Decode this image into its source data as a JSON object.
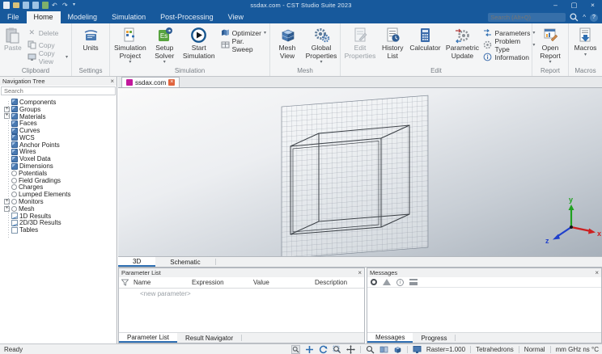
{
  "titlebar": {
    "title": "ssdax.com - CST Studio Suite 2023",
    "window_controls": {
      "minimize": "–",
      "maximize": "▢",
      "close": "×"
    }
  },
  "tabs": {
    "items": [
      "File",
      "Home",
      "Modeling",
      "Simulation",
      "Post-Processing",
      "View"
    ],
    "active": "Home",
    "search_placeholder": "Search (Alt+Q)",
    "collapse_glyph": "^",
    "help_glyph": "?"
  },
  "icons": {
    "caret": "▾",
    "close": "×",
    "plus": "+",
    "play": "▶",
    "solver_badge": "Es"
  },
  "ribbon": {
    "clipboard": {
      "label": "Clipboard",
      "paste": "Paste",
      "delete": "Delete",
      "copy": "Copy",
      "copy_view": "Copy View"
    },
    "settings": {
      "label": "Settings",
      "units": "Units"
    },
    "simulation": {
      "label": "Simulation",
      "simulation_project": "Simulation Project",
      "setup_solver": "Setup Solver",
      "start_simulation": "Start Simulation",
      "optimizer": "Optimizer",
      "par_sweep": "Par. Sweep"
    },
    "mesh": {
      "label": "Mesh",
      "mesh_view": "Mesh View",
      "global_properties": "Global Properties"
    },
    "edit": {
      "label": "Edit",
      "edit_properties": "Edit Properties",
      "history_list": "History List",
      "calculator": "Calculator",
      "parametric_update": "Parametric Update",
      "parameters": "Parameters",
      "problem_type": "Problem Type",
      "information": "Information"
    },
    "report": {
      "label": "Report",
      "open_report": "Open Report"
    },
    "macros": {
      "label": "Macros",
      "macros": "Macros"
    }
  },
  "nav_tree": {
    "title": "Navigation Tree",
    "search_placeholder": "Search",
    "items": [
      {
        "label": "Components"
      },
      {
        "label": "Groups"
      },
      {
        "label": "Materials"
      },
      {
        "label": "Faces"
      },
      {
        "label": "Curves"
      },
      {
        "label": "WCS"
      },
      {
        "label": "Anchor Points"
      },
      {
        "label": "Wires"
      },
      {
        "label": "Voxel Data"
      },
      {
        "label": "Dimensions"
      },
      {
        "label": "Potentials"
      },
      {
        "label": "Field Gradings"
      },
      {
        "label": "Charges"
      },
      {
        "label": "Lumped Elements"
      },
      {
        "label": "Monitors"
      },
      {
        "label": "Mesh"
      },
      {
        "label": "1D Results"
      },
      {
        "label": "2D/3D Results"
      },
      {
        "label": "Tables"
      }
    ]
  },
  "document": {
    "tab_title": "ssdax.com"
  },
  "viewport": {
    "tabs": [
      "3D",
      "Schematic"
    ],
    "active_tab": "3D",
    "axes": {
      "x": "x",
      "y": "y",
      "z": "z"
    },
    "axis_colors": {
      "x": "#cc2020",
      "y": "#1fa11f",
      "z": "#2040cc"
    }
  },
  "parameter_list": {
    "title": "Parameter List",
    "columns": [
      "Name",
      "Expression",
      "Value",
      "Description"
    ],
    "new_parameter_placeholder": "<new parameter>",
    "bottom_tabs": [
      "Parameter List",
      "Result Navigator"
    ],
    "active_tab": "Parameter List"
  },
  "messages": {
    "title": "Messages",
    "bottom_tabs": [
      "Messages",
      "Progress"
    ],
    "active_tab": "Messages"
  },
  "statusbar": {
    "ready": "Ready",
    "raster": "Raster=1.000",
    "mesh_type": "Tetrahedrons",
    "view_mode": "Normal",
    "units": "mm GHz ns °C"
  }
}
